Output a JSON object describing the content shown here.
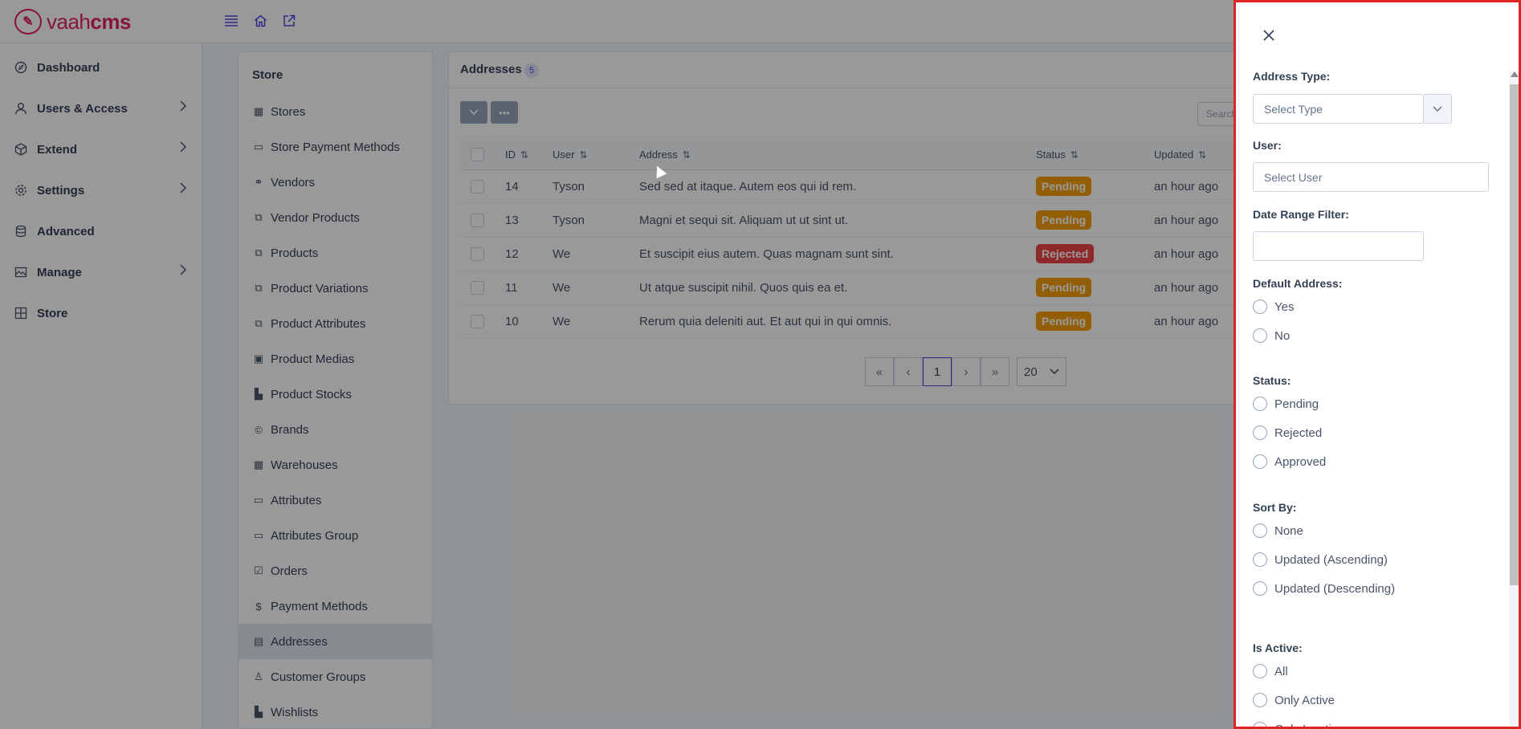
{
  "brand": {
    "text": "vaahcms"
  },
  "topbar": {
    "icons": [
      "menu-icon",
      "home-icon",
      "external-link-icon"
    ]
  },
  "sidebar": {
    "items": [
      {
        "label": "Dashboard",
        "icon": "compass-icon",
        "has_children": false
      },
      {
        "label": "Users & Access",
        "icon": "user-icon",
        "has_children": true
      },
      {
        "label": "Extend",
        "icon": "cube-icon",
        "has_children": true
      },
      {
        "label": "Settings",
        "icon": "gear-icon",
        "has_children": true
      },
      {
        "label": "Advanced",
        "icon": "database-icon",
        "has_children": false
      },
      {
        "label": "Manage",
        "icon": "image-icon",
        "has_children": true
      },
      {
        "label": "Store",
        "icon": "grid-icon",
        "has_children": false
      }
    ]
  },
  "store_menu": {
    "title": "Store",
    "items": [
      "Stores",
      "Store Payment Methods",
      "Vendors",
      "Vendor Products",
      "Products",
      "Product Variations",
      "Product Attributes",
      "Product Medias",
      "Product Stocks",
      "Brands",
      "Warehouses",
      "Attributes",
      "Attributes Group",
      "Orders",
      "Payment Methods",
      "Addresses",
      "Customer Groups",
      "Wishlists"
    ],
    "active": "Addresses"
  },
  "list": {
    "title": "Addresses",
    "count": "5",
    "search_placeholder": "Search",
    "columns": [
      "ID",
      "User",
      "Address",
      "Status",
      "Updated"
    ],
    "rows": [
      {
        "id": "14",
        "user": "Tyson",
        "address": "Sed sed at itaque. Autem eos qui id rem.",
        "status": "Pending",
        "updated": "an hour ago"
      },
      {
        "id": "13",
        "user": "Tyson",
        "address": "Magni et sequi sit. Aliquam ut ut sint ut.",
        "status": "Pending",
        "updated": "an hour ago"
      },
      {
        "id": "12",
        "user": "We",
        "address": "Et suscipit eius autem. Quas magnam sunt sint.",
        "status": "Rejected",
        "updated": "an hour ago"
      },
      {
        "id": "11",
        "user": "We",
        "address": "Ut atque suscipit nihil. Quos quis ea et.",
        "status": "Pending",
        "updated": "an hour ago"
      },
      {
        "id": "10",
        "user": "We",
        "address": "Rerum quia deleniti aut. Et aut qui in qui omnis.",
        "status": "Pending",
        "updated": "an hour ago"
      }
    ],
    "pagination": {
      "current_page": "1",
      "page_size": "20"
    }
  },
  "colors": {
    "brand": "#e0245e",
    "accent": "#4f46e5",
    "pending": "#f59e0b",
    "rejected": "#ef4444",
    "drawer_border": "#dc2626"
  },
  "filter_drawer": {
    "address_type": {
      "label": "Address Type:",
      "placeholder": "Select Type"
    },
    "user": {
      "label": "User:",
      "placeholder": "Select User"
    },
    "date_range": {
      "label": "Date Range Filter:",
      "value": ""
    },
    "default_address": {
      "label": "Default Address:",
      "options": [
        "Yes",
        "No"
      ]
    },
    "status": {
      "label": "Status:",
      "options": [
        "Pending",
        "Rejected",
        "Approved"
      ]
    },
    "sort_by": {
      "label": "Sort By:",
      "options": [
        "None",
        "Updated (Ascending)",
        "Updated (Descending)"
      ]
    },
    "is_active": {
      "label": "Is Active:",
      "options": [
        "All",
        "Only Active",
        "Only Inactive"
      ]
    }
  }
}
